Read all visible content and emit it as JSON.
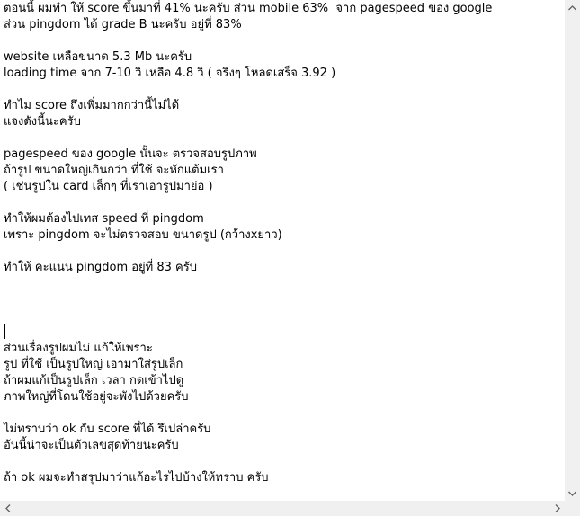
{
  "editor": {
    "lines": [
      "ตอนนี้ ผมทำ ให้ score ขึ้นมาที่ 41% นะครับ ส่วน mobile 63%  จาก pagespeed ของ google",
      "ส่วน pingdom ได้ grade B นะครับ อยู่ที่ 83%",
      "",
      "website เหลือขนาด 5.3 Mb นะครับ",
      "loading time จาก 7-10 วิ เหลือ 4.8 วิ ( จริงๆ โหลดเสร็จ 3.92 )",
      "",
      "ทำไม score ถึงเพิ่มมากกว่านี้ไม่ได้",
      "แจงดังนี้นะครับ",
      "",
      "pagespeed ของ google นั้นจะ ตรวจสอบรูปภาพ",
      "ถ้ารูป ขนาดใหญ่เกินกว่า ที่ใช้ จะหักแต้มเรา",
      "( เช่นรูปใน card เล็กๆ ที่เราเอารูปมาย่อ )",
      "",
      "ทำให้ผมต้องไปเทส speed ที่ pingdom",
      "เพราะ pingdom จะไม่ตรวจสอบ ขนาดรูป (กว้างxยาว)",
      "",
      "ทำให้ คะแนน pingdom อยู่ที่ 83 ครับ",
      "",
      "",
      "",
      "",
      "ส่วนเรื่องรูปผมไม่ แก้ให้เพราะ",
      "รูป ที่ใช้ เป็นรูปใหญ่ เอามาใส่รูปเล็ก",
      "ถ้าผมแก้เป็นรูปเล็ก เวลา กดเข้าไปดู",
      "ภาพใหญ่ที่โดนใช้อยู่จะพังไปด้วยครับ",
      "",
      "ไม่ทราบว่า ok กับ score ที่ได้ รึเปล่าครับ",
      "อันนี้น่าจะเป็นตัวเลขสุดท้ายนะครับ",
      "",
      "ถ้า ok ผมจะทำสรุปมาว่าแก้อะไรไปบ้างให้ทราบ ครับ"
    ]
  },
  "icons": {
    "scroll_up": "chevron-up-icon",
    "scroll_down": "chevron-down-icon",
    "scroll_left": "chevron-left-icon",
    "scroll_right": "chevron-right-icon"
  },
  "colors": {
    "text": "#000000",
    "background": "#ffffff",
    "scrollbar": "#f0f0f0",
    "arrow": "#606060"
  }
}
